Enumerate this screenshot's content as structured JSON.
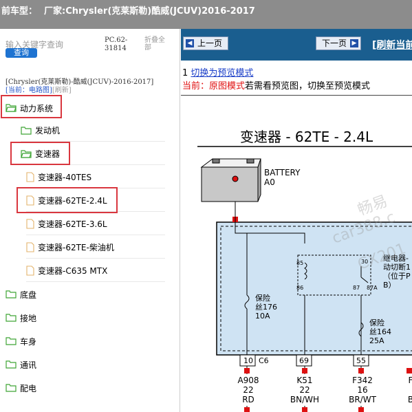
{
  "header": {
    "label": "前车型：",
    "vendor_label": "厂家:",
    "model": "Chrysler(克莱斯勒)酷威(JCUV)2016-2017"
  },
  "left": {
    "search_placeholder": "输入关键字查询",
    "search_button": "查询",
    "code": [
      "PC.62-",
      "31814"
    ],
    "collapse_all": [
      "折叠全",
      "部"
    ],
    "breadcrumb": "[Chrysler(克莱斯勒)-酷威(JCUV)-2016-2017]",
    "current_label": "[当前：电路图]",
    "refresh_label": "[刷新]",
    "tree": [
      {
        "label": "动力系统",
        "type": "folder"
      },
      {
        "label": "发动机",
        "type": "folder"
      },
      {
        "label": "变速器",
        "type": "folder"
      },
      {
        "label": "变速器-40TES",
        "type": "doc"
      },
      {
        "label": "变速器-62TE-2.4L",
        "type": "doc"
      },
      {
        "label": "变速器-62TE-3.6L",
        "type": "doc"
      },
      {
        "label": "变速器-62TE-柴油机",
        "type": "doc"
      },
      {
        "label": "变速器-C635 MTX",
        "type": "doc"
      },
      {
        "label": "底盘",
        "type": "folder"
      },
      {
        "label": "接地",
        "type": "folder"
      },
      {
        "label": "车身",
        "type": "folder"
      },
      {
        "label": "通讯",
        "type": "folder"
      },
      {
        "label": "配电",
        "type": "folder"
      }
    ]
  },
  "right": {
    "prev_button": "上一页",
    "next_button": "下一页",
    "refresh": "[刷新当前",
    "mode_index": "1",
    "switch_link": "切换为预览模式",
    "current_mode_prefix": "当前：",
    "current_mode": "原图模式",
    "mode_hint": "若需看预览图，切换至预览模式",
    "diagram": {
      "title": "变速器 - 62TE - 2.4L",
      "battery_label": [
        "BATTERY",
        "A0"
      ],
      "relay_label": [
        "继电器-",
        "动切断1",
        "（位于P",
        "B）"
      ],
      "fuse1": [
        "保险",
        "丝176",
        "10A"
      ],
      "fuse2": [
        "保险",
        "丝164",
        "25A"
      ],
      "relay_pins": [
        "85",
        "86",
        "30",
        "87",
        "87A"
      ],
      "connectors": [
        {
          "pin": "10",
          "conn": "C6",
          "wire": "A908",
          "gauge": "22",
          "color": "RD"
        },
        {
          "pin": "69",
          "conn": "",
          "wire": "K51",
          "gauge": "22",
          "color": "BN/WH"
        },
        {
          "pin": "55",
          "conn": "",
          "wire": "F342",
          "gauge": "16",
          "color": "BR/WT"
        },
        {
          "pin": "",
          "conn": "",
          "wire": "F",
          "gauge": "",
          "color": "B"
        }
      ],
      "watermarks": [
        "畅易",
        "car388.c",
        "CX201"
      ]
    }
  },
  "colors": {
    "header_bg": "#8c8c8c",
    "nav_bg": "#1a5e8f",
    "highlight_red": "#d9363e",
    "link_blue": "#1a3ec8",
    "folder_green": "#3fa535",
    "diagram_fill": "#cfe3f3"
  }
}
